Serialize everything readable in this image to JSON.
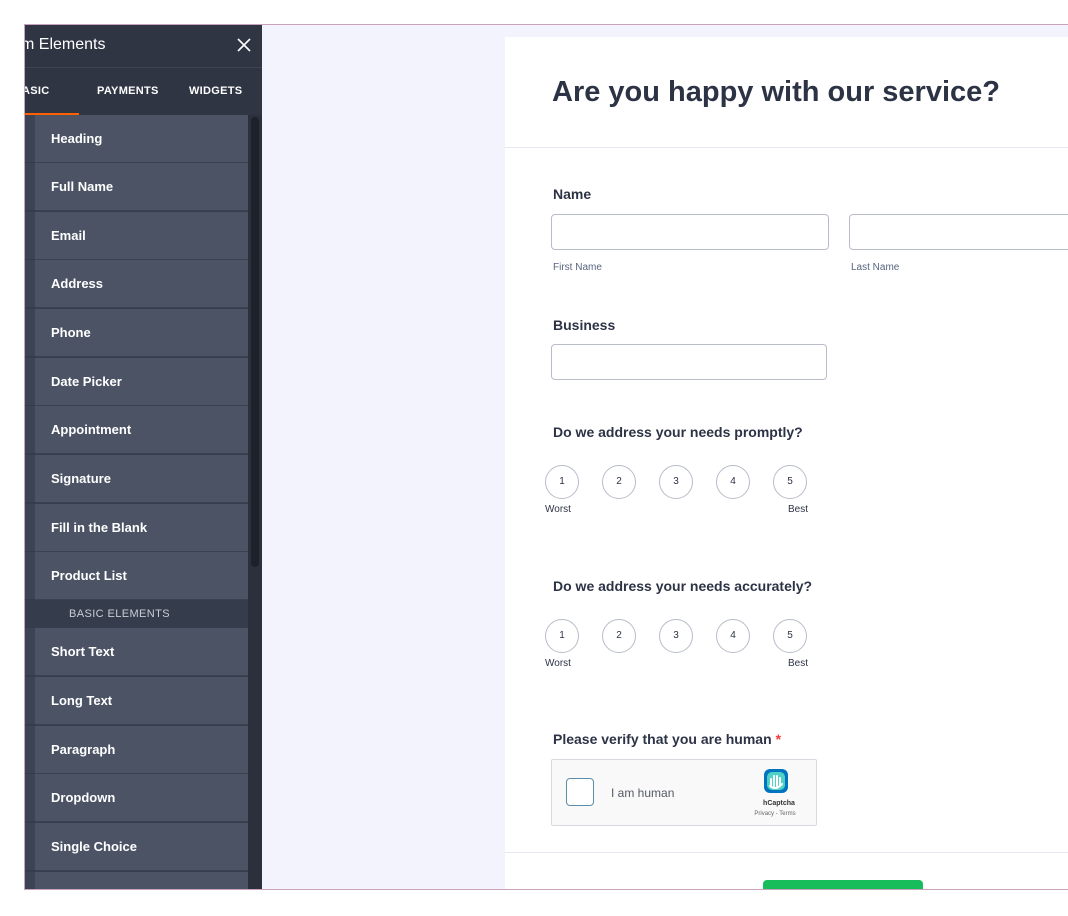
{
  "panel": {
    "title": "m Elements",
    "tabs": [
      {
        "label": "ASIC",
        "active": true
      },
      {
        "label": "PAYMENTS",
        "active": false
      },
      {
        "label": "WIDGETS",
        "active": false
      }
    ],
    "items": [
      {
        "label": "Heading"
      },
      {
        "label": "Full Name"
      },
      {
        "label": "Email"
      },
      {
        "label": "Address"
      },
      {
        "label": "Phone"
      },
      {
        "label": "Date Picker"
      },
      {
        "label": "Appointment"
      },
      {
        "label": "Signature"
      },
      {
        "label": "Fill in the Blank"
      },
      {
        "label": "Product List"
      }
    ],
    "section_header": "BASIC ELEMENTS",
    "basic_items": [
      {
        "label": "Short Text"
      },
      {
        "label": "Long Text"
      },
      {
        "label": "Paragraph"
      },
      {
        "label": "Dropdown"
      },
      {
        "label": "Single Choice"
      }
    ],
    "accent_color": "#ff6100"
  },
  "form": {
    "title": "Are you happy with our service?",
    "name": {
      "label": "Name",
      "first_value": "",
      "last_value": "",
      "first_sublabel": "First Name",
      "last_sublabel": "Last Name"
    },
    "business": {
      "label": "Business",
      "value": ""
    },
    "q1": {
      "label": "Do we address your needs promptly?",
      "options": [
        "1",
        "2",
        "3",
        "4",
        "5"
      ],
      "low": "Worst",
      "high": "Best"
    },
    "q2": {
      "label": "Do we address your needs accurately?",
      "options": [
        "1",
        "2",
        "3",
        "4",
        "5"
      ],
      "low": "Worst",
      "high": "Best"
    },
    "verify": {
      "label": "Please verify that you are human",
      "required_mark": "*"
    },
    "captcha": {
      "label": "I am human",
      "brand": "hCaptcha",
      "links": "Privacy - Terms"
    },
    "submit_color": "#18bd5b"
  }
}
